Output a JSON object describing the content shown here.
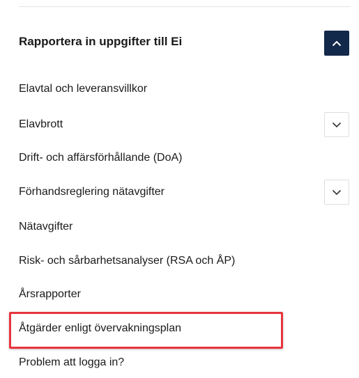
{
  "menu": {
    "title": "Rapportera in uppgifter till Ei",
    "items": [
      {
        "label": "Elavtal och leveransvillkor",
        "has_submenu": false
      },
      {
        "label": "Elavbrott",
        "has_submenu": true
      },
      {
        "label": "Drift- och affärsförhållande (DoA)",
        "has_submenu": false
      },
      {
        "label": "Förhandsreglering nätavgifter",
        "has_submenu": true
      },
      {
        "label": "Nätavgifter",
        "has_submenu": false
      },
      {
        "label": "Risk- och sårbarhetsanalyser (RSA och ÅP)",
        "has_submenu": false
      },
      {
        "label": "Årsrapporter",
        "has_submenu": false
      },
      {
        "label": "Åtgärder enligt övervakningsplan",
        "has_submenu": false,
        "highlighted": true
      },
      {
        "label": "Problem att logga in?",
        "has_submenu": false
      }
    ]
  },
  "icons": {
    "collapse": "chevron-up-icon",
    "expand": "chevron-down-icon"
  },
  "colors": {
    "collapse_button_bg": "#13294b",
    "highlight_border": "#e8353d"
  }
}
